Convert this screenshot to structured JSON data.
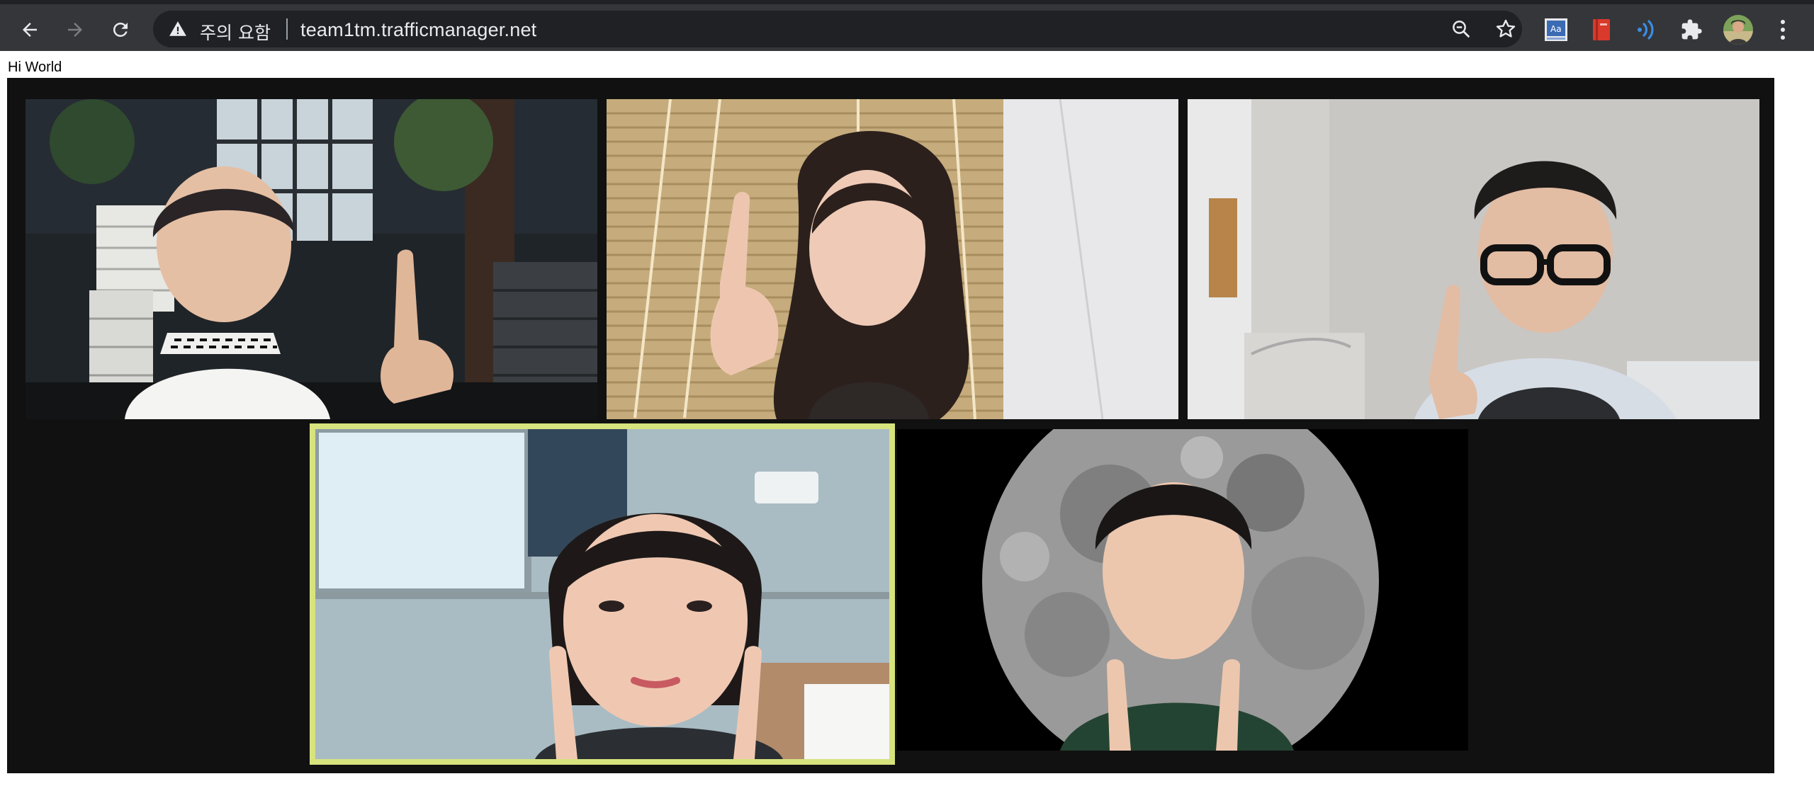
{
  "browser": {
    "security_label": "주의 요함",
    "url": "team1tm.trafficmanager.net",
    "nav": {
      "back_icon": "back-arrow-icon",
      "forward_icon": "forward-arrow-icon",
      "reload_icon": "reload-icon"
    },
    "omnibox_icons": [
      "warning-icon",
      "zoom-out-icon",
      "bookmark-star-icon"
    ],
    "extensions": [
      "dictionary-extension-icon",
      "red-book-extension-icon",
      "audio-waves-extension-icon",
      "puzzle-extensions-icon",
      "profile-avatar-icon",
      "more-menu-icon"
    ]
  },
  "page": {
    "label": "Hi World"
  },
  "video_call": {
    "active_speaker_color": "#d7e37d",
    "participants": [
      {
        "id": "p1",
        "background": "dark living room"
      },
      {
        "id": "p2",
        "background": "window blinds"
      },
      {
        "id": "p3",
        "background": "bedroom wall"
      },
      {
        "id": "p4",
        "background": "apartment room",
        "speaking": true
      },
      {
        "id": "p5",
        "background": "full moon"
      }
    ]
  }
}
